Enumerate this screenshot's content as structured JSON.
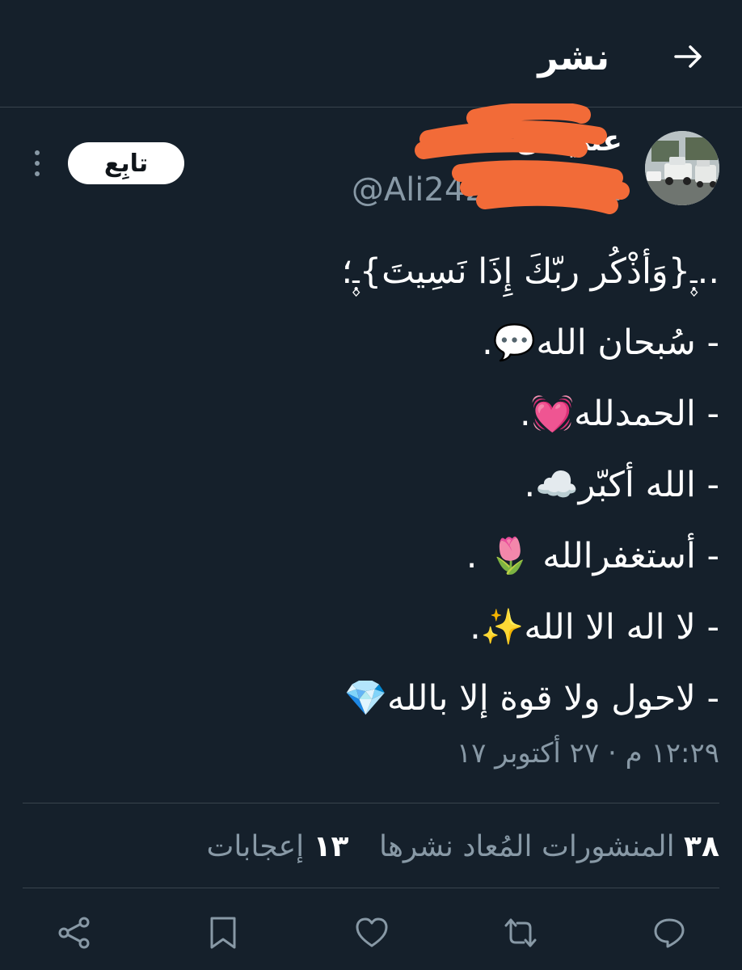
{
  "header": {
    "title": "نشر",
    "back_icon": "arrow-right-icon"
  },
  "author": {
    "display_name": "علي ال",
    "handle": "@Ali2424Ismail1",
    "follow_label": "تابِع",
    "avatar_icon": "avatar-photo-cars"
  },
  "tweet": {
    "lines": [
      "..ـ۪ٜ{وَأذْكُر ربّكَ إِذَا نَسِيتَ}ـ۪ٜ؛",
      "- سُبحان الله💬.",
      "- الحمدلله💓.",
      "- الله أكبّر☁️.",
      "- أستغفرالله 🌷 .",
      "- لا اله الا الله✨.",
      "- لاحول ولا قوة إلا بالله💎"
    ],
    "timestamp": "١٢:٢٩ م · ٢٧ أكتوبر ١٧"
  },
  "stats": {
    "retweets_count": "٣٨",
    "retweets_label": "المنشورات المُعاد نشرها",
    "likes_count": "١٣",
    "likes_label": "إعجابات"
  },
  "actions": [
    "reply-icon",
    "retweet-icon",
    "like-icon",
    "bookmark-icon",
    "share-icon"
  ],
  "colors": {
    "background": "#15202b",
    "secondary_text": "#8899a6",
    "divider": "#38444d",
    "redaction": "#f26b38"
  }
}
